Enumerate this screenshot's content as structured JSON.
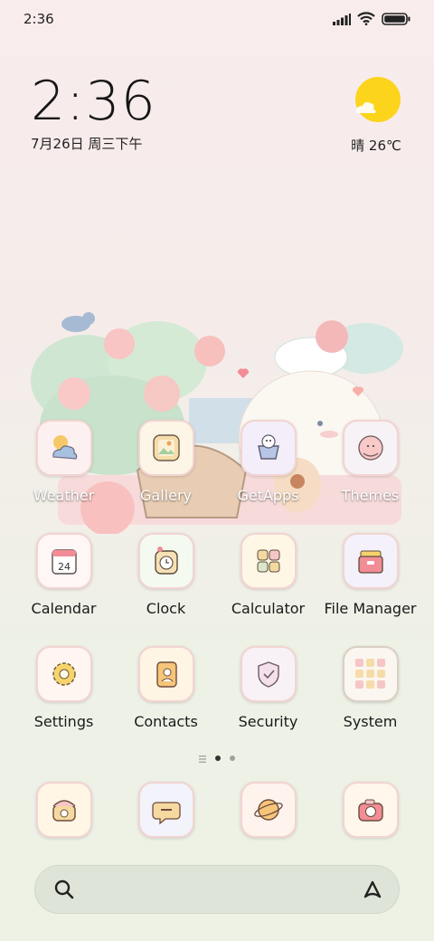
{
  "status_bar": {
    "time": "2:36"
  },
  "clock_widget": {
    "time": "2:36",
    "date": "7月26日 周三下午"
  },
  "weather_widget": {
    "text": "晴 26℃",
    "sun_color": "#fcd41c"
  },
  "apps": [
    [
      {
        "label": "Weather",
        "icon": "weather-icon",
        "light": true
      },
      {
        "label": "Gallery",
        "icon": "gallery-icon",
        "light": true
      },
      {
        "label": "GetApps",
        "icon": "getapps-icon",
        "light": true
      },
      {
        "label": "Themes",
        "icon": "themes-icon",
        "light": true
      }
    ],
    [
      {
        "label": "Calendar",
        "icon": "calendar-icon"
      },
      {
        "label": "Clock",
        "icon": "clock-icon"
      },
      {
        "label": "Calculator",
        "icon": "calculator-icon"
      },
      {
        "label": "File Manager",
        "icon": "file-manager-icon"
      }
    ],
    [
      {
        "label": "Settings",
        "icon": "settings-icon"
      },
      {
        "label": "Contacts",
        "icon": "contacts-icon"
      },
      {
        "label": "Security",
        "icon": "security-icon"
      },
      {
        "label": "System",
        "icon": "system-folder-icon"
      }
    ]
  ],
  "calendar_day": "24",
  "dock": [
    {
      "icon": "phone-icon"
    },
    {
      "icon": "messages-icon"
    },
    {
      "icon": "browser-icon"
    },
    {
      "icon": "camera-icon"
    }
  ],
  "pager": {
    "pages": 2,
    "current": 1
  },
  "colors": {
    "accent_pink": "#e98b92",
    "accent_yellow": "#f6d46b"
  }
}
